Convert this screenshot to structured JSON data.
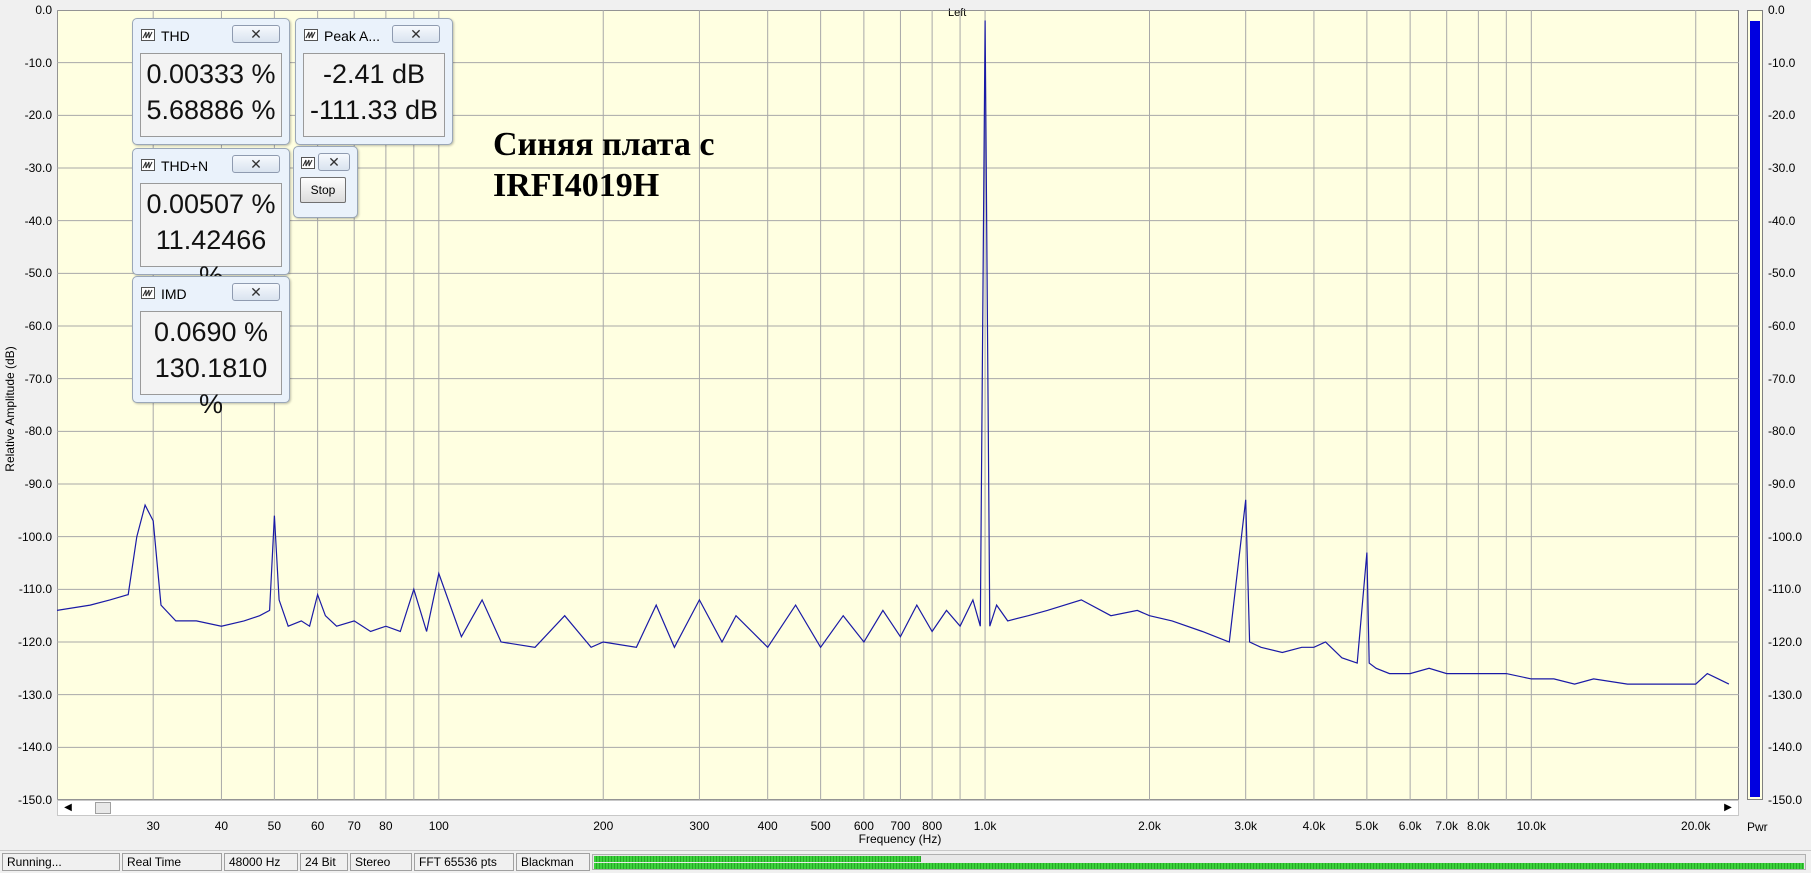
{
  "channel_label": "Left",
  "annotation": {
    "line1": "Синяя плата с",
    "line2": "IRFI4019H"
  },
  "axes": {
    "y_label": "Relative Amplitude (dB)",
    "x_label": "Frequency (Hz)",
    "y_ticks": [
      "0.0",
      "-10.0",
      "-20.0",
      "-30.0",
      "-40.0",
      "-50.0",
      "-60.0",
      "-70.0",
      "-80.0",
      "-90.0",
      "-100.0",
      "-110.0",
      "-120.0",
      "-130.0",
      "-140.0",
      "-150.0"
    ],
    "x_ticks": [
      {
        "f": 30,
        "label": "30"
      },
      {
        "f": 40,
        "label": "40"
      },
      {
        "f": 50,
        "label": "50"
      },
      {
        "f": 60,
        "label": "60"
      },
      {
        "f": 70,
        "label": "70"
      },
      {
        "f": 80,
        "label": "80"
      },
      {
        "f": 100,
        "label": "100"
      },
      {
        "f": 200,
        "label": "200"
      },
      {
        "f": 300,
        "label": "300"
      },
      {
        "f": 400,
        "label": "400"
      },
      {
        "f": 500,
        "label": "500"
      },
      {
        "f": 600,
        "label": "600"
      },
      {
        "f": 700,
        "label": "700"
      },
      {
        "f": 800,
        "label": "800"
      },
      {
        "f": 1000,
        "label": "1.0k"
      },
      {
        "f": 2000,
        "label": "2.0k"
      },
      {
        "f": 3000,
        "label": "3.0k"
      },
      {
        "f": 4000,
        "label": "4.0k"
      },
      {
        "f": 5000,
        "label": "5.0k"
      },
      {
        "f": 6000,
        "label": "6.0k"
      },
      {
        "f": 7000,
        "label": "7.0k"
      },
      {
        "f": 8000,
        "label": "8.0k"
      },
      {
        "f": 10000,
        "label": "10.0k"
      },
      {
        "f": 20000,
        "label": "20.0k"
      }
    ]
  },
  "meters": {
    "thd": {
      "title": "THD",
      "close_icon": "close-icon",
      "line1": "0.00333 %",
      "line2": "5.68886 %"
    },
    "peak": {
      "title": "Peak A...",
      "close_icon": "close-icon",
      "line1": "-2.41 dB",
      "line2": "-111.33 dB"
    },
    "thdn": {
      "title": "THD+N",
      "close_icon": "close-icon",
      "line1": "0.00507 %",
      "line2": "11.42466 %"
    },
    "imd": {
      "title": "IMD",
      "close_icon": "close-icon",
      "line1": "0.0690 %",
      "line2": "130.1810 %"
    },
    "control": {
      "stop_label": "Stop"
    }
  },
  "power_meter": {
    "label": "Pwr",
    "ticks": [
      "0.0",
      "-10.0",
      "-20.0",
      "-30.0",
      "-40.0",
      "-50.0",
      "-60.0",
      "-70.0",
      "-80.0",
      "-90.0",
      "-100.0",
      "-110.0",
      "-120.0",
      "-130.0",
      "-140.0",
      "-150.0"
    ],
    "level_db": -2
  },
  "status_bar": {
    "state": "Running...",
    "mode": "Real Time",
    "sample_rate": "48000 Hz",
    "bit_depth": "24 Bit",
    "channels": "Stereo",
    "fft": "FFT 65536 pts",
    "window": "Blackman",
    "level_left_fraction": 0.27,
    "level_right_fraction": 1.0
  },
  "colors": {
    "plot_bg": "#ffffe1",
    "trace": "#1a1aa6",
    "grid": "#a8a8a8",
    "power_fill": "#0000e0"
  },
  "chart_data": {
    "type": "line",
    "title": "",
    "xlabel": "Frequency (Hz)",
    "ylabel": "Relative Amplitude (dB)",
    "x_scale": "log",
    "xlim": [
      20,
      24000
    ],
    "ylim": [
      -150,
      0
    ],
    "grid": true,
    "series": [
      {
        "x": [
          20,
          23,
          25,
          27,
          28,
          29,
          30,
          31,
          33,
          36,
          40,
          44,
          47,
          49,
          50,
          51,
          53,
          56,
          58,
          60,
          62,
          65,
          70,
          75,
          80,
          85,
          90,
          95,
          100,
          110,
          120,
          130,
          150,
          170,
          190,
          200,
          230,
          250,
          270,
          300,
          330,
          350,
          400,
          450,
          500,
          550,
          600,
          650,
          700,
          750,
          800,
          850,
          900,
          950,
          980,
          1000,
          1020,
          1050,
          1100,
          1200,
          1300,
          1500,
          1700,
          1900,
          2000,
          2200,
          2500,
          2800,
          3000,
          3050,
          3200,
          3500,
          3800,
          4000,
          4200,
          4500,
          4800,
          5000,
          5050,
          5200,
          5500,
          6000,
          6500,
          7000,
          8000,
          9000,
          10000,
          11000,
          12000,
          13000,
          15000,
          17000,
          19000,
          20000,
          21000,
          22000,
          23000
        ],
        "y": [
          -114,
          -113,
          -112,
          -111,
          -100,
          -94,
          -97,
          -113,
          -116,
          -116,
          -117,
          -116,
          -115,
          -114,
          -96,
          -112,
          -117,
          -116,
          -117,
          -111,
          -115,
          -117,
          -116,
          -118,
          -117,
          -118,
          -110,
          -118,
          -107,
          -119,
          -112,
          -120,
          -121,
          -115,
          -121,
          -120,
          -121,
          -113,
          -121,
          -112,
          -120,
          -115,
          -121,
          -113,
          -121,
          -115,
          -120,
          -114,
          -119,
          -113,
          -118,
          -114,
          -117,
          -112,
          -117,
          -2,
          -117,
          -113,
          -116,
          -115,
          -114,
          -112,
          -115,
          -114,
          -115,
          -116,
          -118,
          -120,
          -93,
          -120,
          -121,
          -122,
          -121,
          -121,
          -120,
          -123,
          -124,
          -103,
          -124,
          -125,
          -126,
          -126,
          -125,
          -126,
          -126,
          -126,
          -127,
          -127,
          -128,
          -127,
          -128,
          -128,
          -128,
          -128,
          -126,
          -127,
          -128
        ]
      }
    ]
  }
}
